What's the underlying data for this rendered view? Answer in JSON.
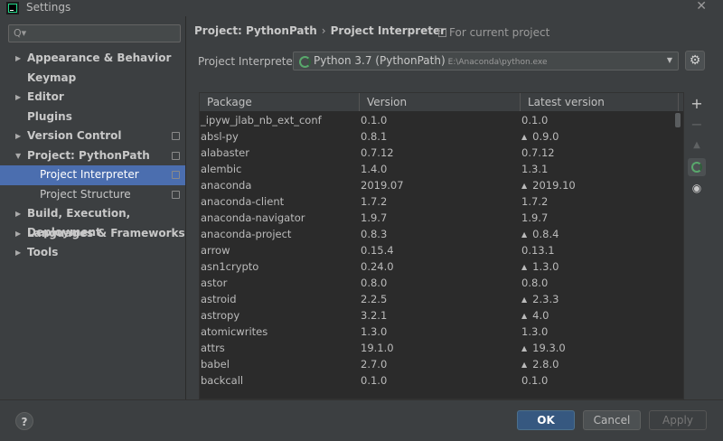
{
  "window": {
    "title": "Settings"
  },
  "search": {
    "placeholder": ""
  },
  "sidebar": {
    "items": [
      {
        "label": "Appearance & Behavior",
        "arrow": "▶"
      },
      {
        "label": "Keymap",
        "arrow": ""
      },
      {
        "label": "Editor",
        "arrow": "▶"
      },
      {
        "label": "Plugins",
        "arrow": ""
      },
      {
        "label": "Version Control",
        "arrow": "▶"
      },
      {
        "label": "Project: PythonPath",
        "arrow": "▼"
      },
      {
        "label": "Project Interpreter",
        "arrow": ""
      },
      {
        "label": "Project Structure",
        "arrow": ""
      },
      {
        "label": "Build, Execution, Deployment",
        "arrow": "▶"
      },
      {
        "label": "Languages & Frameworks",
        "arrow": "▶"
      },
      {
        "label": "Tools",
        "arrow": "▶"
      }
    ]
  },
  "breadcrumb": {
    "project": "Project: PythonPath",
    "separator": "›",
    "page": "Project Interpreter"
  },
  "for_current_project": "For current project",
  "interpreter": {
    "label": "Project Interpreter:",
    "name": "Python 3.7 (PythonPath)",
    "path": "E:\\Anaconda\\python.exe"
  },
  "table": {
    "headers": [
      "Package",
      "Version",
      "Latest version"
    ],
    "rows": [
      {
        "package": "_ipyw_jlab_nb_ext_conf",
        "version": "0.1.0",
        "latest": "0.1.0",
        "upgrade": false
      },
      {
        "package": "absl-py",
        "version": "0.8.1",
        "latest": "0.9.0",
        "upgrade": true
      },
      {
        "package": "alabaster",
        "version": "0.7.12",
        "latest": "0.7.12",
        "upgrade": false
      },
      {
        "package": "alembic",
        "version": "1.4.0",
        "latest": "1.3.1",
        "upgrade": false
      },
      {
        "package": "anaconda",
        "version": "2019.07",
        "latest": "2019.10",
        "upgrade": true
      },
      {
        "package": "anaconda-client",
        "version": "1.7.2",
        "latest": "1.7.2",
        "upgrade": false
      },
      {
        "package": "anaconda-navigator",
        "version": "1.9.7",
        "latest": "1.9.7",
        "upgrade": false
      },
      {
        "package": "anaconda-project",
        "version": "0.8.3",
        "latest": "0.8.4",
        "upgrade": true
      },
      {
        "package": "arrow",
        "version": "0.15.4",
        "latest": "0.13.1",
        "upgrade": false
      },
      {
        "package": "asn1crypto",
        "version": "0.24.0",
        "latest": "1.3.0",
        "upgrade": true
      },
      {
        "package": "astor",
        "version": "0.8.0",
        "latest": "0.8.0",
        "upgrade": false
      },
      {
        "package": "astroid",
        "version": "2.2.5",
        "latest": "2.3.3",
        "upgrade": true
      },
      {
        "package": "astropy",
        "version": "3.2.1",
        "latest": "4.0",
        "upgrade": true
      },
      {
        "package": "atomicwrites",
        "version": "1.3.0",
        "latest": "1.3.0",
        "upgrade": false
      },
      {
        "package": "attrs",
        "version": "19.1.0",
        "latest": "19.3.0",
        "upgrade": true
      },
      {
        "package": "babel",
        "version": "2.7.0",
        "latest": "2.8.0",
        "upgrade": true
      },
      {
        "package": "backcall",
        "version": "0.1.0",
        "latest": "0.1.0",
        "upgrade": false
      }
    ]
  },
  "tools": {
    "add": "+",
    "remove": "−",
    "upgrade": "▲",
    "show": "👁"
  },
  "buttons": {
    "help": "?",
    "ok": "OK",
    "cancel": "Cancel",
    "apply": "Apply"
  },
  "icons": [
    "app-icon",
    "close-icon",
    "search-icon",
    "gear-icon",
    "copy-icon",
    "eye-icon",
    "upgrade-arrow-icon",
    "loading-ring-icon"
  ]
}
